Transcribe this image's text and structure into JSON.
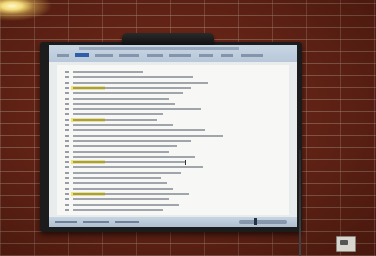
{
  "scene": {
    "subject": "interactive-whiteboard-on-brick-wall",
    "screen_content": "word-processor-document",
    "document_lines": 27,
    "highlighted_lines": [
      3,
      9,
      17,
      23
    ],
    "menu_tabs": 9,
    "active_menu_tab": 1,
    "colors": {
      "brick": "#6e2818",
      "mortar": "#d2beaa",
      "frame": "#1c1c1c",
      "screen": "#e9ecec",
      "ribbon": "#c9d6e3",
      "highlight": "#f1e15a",
      "light": "#f3dc79"
    },
    "icons": [
      "ceiling-light",
      "projector-bar",
      "wall-socket",
      "power-cable"
    ]
  }
}
